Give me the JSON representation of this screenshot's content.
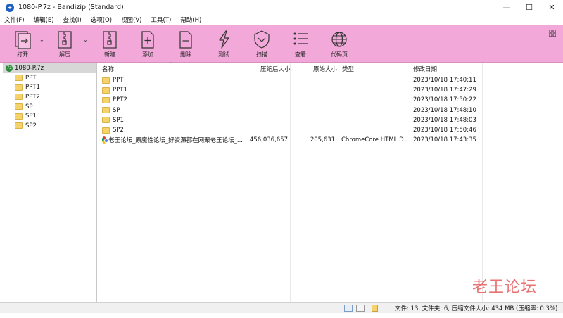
{
  "window": {
    "title": "1080-P.7z - Bandizip (Standard)",
    "app_icon_glyph": "+",
    "controls": {
      "minimize": "—",
      "maximize": "☐",
      "close": "✕"
    }
  },
  "menu": [
    "文件(F)",
    "编辑(E)",
    "查找(I)",
    "选项(O)",
    "视图(V)",
    "工具(T)",
    "帮助(H)"
  ],
  "toolbar": {
    "buttons": [
      {
        "label": "打开",
        "icon": "open-icon"
      },
      {
        "label": "解压",
        "icon": "extract-icon"
      },
      {
        "label": "新建",
        "icon": "new-archive-icon"
      },
      {
        "label": "添加",
        "icon": "add-icon"
      },
      {
        "label": "删除",
        "icon": "delete-icon"
      },
      {
        "label": "测试",
        "icon": "test-icon"
      },
      {
        "label": "扫描",
        "icon": "scan-icon"
      },
      {
        "label": "查看",
        "icon": "view-icon"
      },
      {
        "label": "代码页",
        "icon": "codepage-icon"
      }
    ],
    "dropdown_glyph": "⌄",
    "accent_color": "#f2a8d8"
  },
  "tree": {
    "root": "1080-P.7z",
    "items": [
      "PPT",
      "PPT1",
      "PPT2",
      "SP",
      "SP1",
      "SP2"
    ]
  },
  "columns": {
    "name": "名称",
    "compressed": "压缩后大小",
    "original": "原始大小",
    "type": "类型",
    "modified": "修改日期",
    "sort_glyph": "^"
  },
  "files": [
    {
      "name": "PPT",
      "compressed": "",
      "original": "",
      "type": "",
      "modified": "2023/10/18 17:40:11",
      "icon": "folder"
    },
    {
      "name": "PPT1",
      "compressed": "",
      "original": "",
      "type": "",
      "modified": "2023/10/18 17:47:29",
      "icon": "folder"
    },
    {
      "name": "PPT2",
      "compressed": "",
      "original": "",
      "type": "",
      "modified": "2023/10/18 17:50:22",
      "icon": "folder"
    },
    {
      "name": "SP",
      "compressed": "",
      "original": "",
      "type": "",
      "modified": "2023/10/18 17:48:10",
      "icon": "folder"
    },
    {
      "name": "SP1",
      "compressed": "",
      "original": "",
      "type": "",
      "modified": "2023/10/18 17:48:03",
      "icon": "folder"
    },
    {
      "name": "SP2",
      "compressed": "",
      "original": "",
      "type": "",
      "modified": "2023/10/18 17:50:46",
      "icon": "folder"
    },
    {
      "name": "老王论坛_原魔性论坛_好资源都在网聚老王论坛_...",
      "compressed": "456,036,657",
      "original": "205,631",
      "type": "ChromeCore HTML D...",
      "modified": "2023/10/18 17:43:35",
      "icon": "chrome"
    }
  ],
  "status": {
    "text": "文件: 13, 文件夹: 6, 压缩文件大小: 434 MB (压缩率: 0.3%)"
  },
  "watermark": "老王论坛"
}
